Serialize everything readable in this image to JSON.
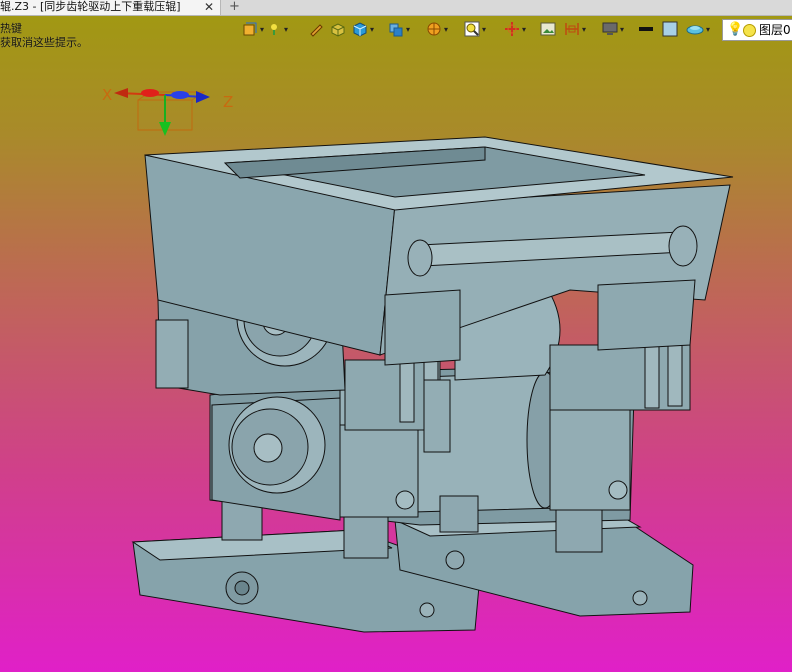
{
  "document_tab": {
    "title": "辊.Z3 - [同步齿轮驱动上下重载压辊]",
    "close_glyph": "✕",
    "add_glyph": "+"
  },
  "hint_lines": [
    "热键",
    "获取消这些提示。"
  ],
  "toolbar": {
    "layer_label": "图层0"
  },
  "triad": {
    "x_label": "X",
    "z_label": "Z"
  },
  "colors": {
    "viewport_top": "#a09a10",
    "viewport_bottom": "#e020c8",
    "model_fill": "#8fa9b1",
    "model_edge": "#111111"
  }
}
